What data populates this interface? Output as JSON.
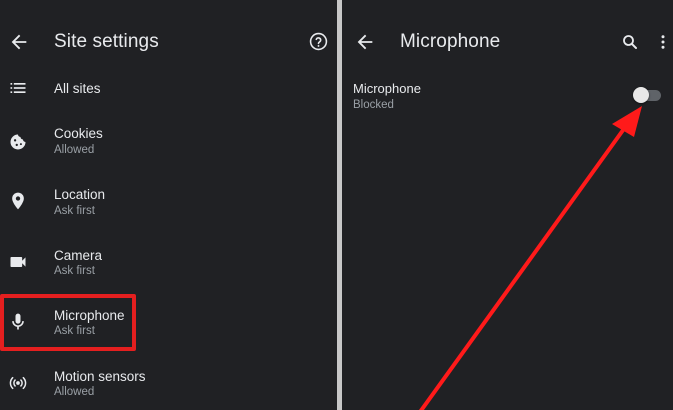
{
  "left": {
    "title": "Site settings",
    "items": [
      {
        "label": "All sites",
        "sub": ""
      },
      {
        "label": "Cookies",
        "sub": "Allowed"
      },
      {
        "label": "Location",
        "sub": "Ask first"
      },
      {
        "label": "Camera",
        "sub": "Ask first"
      },
      {
        "label": "Microphone",
        "sub": "Ask first"
      },
      {
        "label": "Motion sensors",
        "sub": "Allowed"
      }
    ]
  },
  "right": {
    "title": "Microphone",
    "setting": {
      "label": "Microphone",
      "sub": "Blocked",
      "enabled": false
    }
  },
  "colors": {
    "background": "#202124",
    "divider": "#c8c8c8",
    "annotation": "#e41f1f",
    "secondary_text": "#9aa0a6"
  }
}
